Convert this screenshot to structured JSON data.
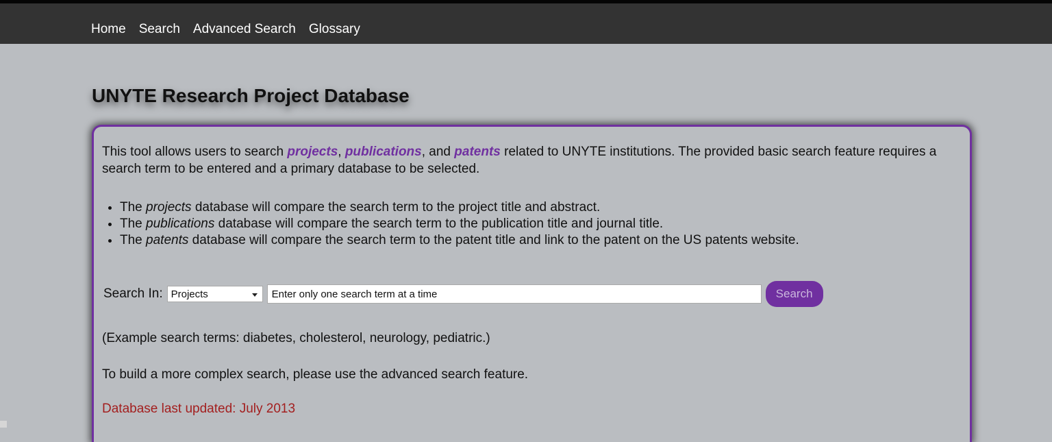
{
  "nav": {
    "items": [
      "Home",
      "Search",
      "Advanced Search",
      "Glossary"
    ]
  },
  "page": {
    "title": "UNYTE Research Project Database"
  },
  "intro": {
    "text_1": "This tool allows users to search ",
    "kw_projects": "projects",
    "sep_1": ", ",
    "kw_publications": "publications",
    "sep_2": ", and ",
    "kw_patents": "patents",
    "text_2": " related to UNYTE institutions. The provided basic search feature requires a search term to be entered and a primary database to be selected."
  },
  "bullets": [
    {
      "pre": "The ",
      "em": "projects",
      "post": " database will compare the search term to the project title and abstract."
    },
    {
      "pre": "The ",
      "em": "publications",
      "post": " database will compare the search term to the publication title and journal title."
    },
    {
      "pre": "The ",
      "em": "patents",
      "post": " database will compare the search term to the patent title and link to the patent on the US patents website."
    }
  ],
  "search": {
    "label": "Search In:",
    "selected_db": "Projects",
    "input_value": "Enter only one search term at a time",
    "button_label": "Search"
  },
  "examples_text": "(Example search terms: diabetes, cholesterol, neurology, pediatric.)",
  "advanced_text": "To build a more complex search, please use the advanced search feature.",
  "updated_text": "Database last updated: July 2013",
  "colors": {
    "accent": "#7030a0",
    "navbar": "#333333",
    "background": "#babdc1",
    "updated": "#a31f1f"
  }
}
